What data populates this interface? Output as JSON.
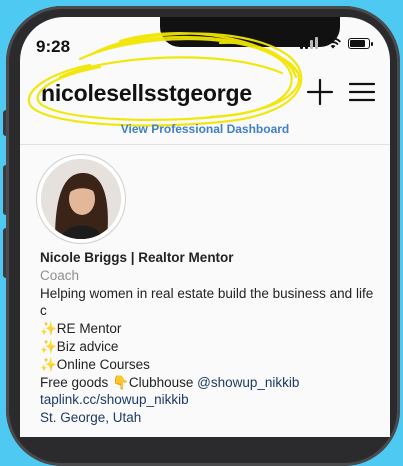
{
  "status_bar": {
    "time": "9:28"
  },
  "header": {
    "username": "nicolesellsstgeorge"
  },
  "dashboard": {
    "label": "View Professional Dashboard"
  },
  "profile": {
    "name": "Nicole Briggs | Realtor Mentor",
    "category": "Coach",
    "bio_intro": "Helping women in real estate build the business and life c",
    "bullets": [
      "✨RE Mentor",
      "✨Biz advice",
      "✨Online Courses"
    ],
    "free_goods_text": "Free goods 👇Clubhouse",
    "clubhouse_handle": "@showup_nikkib",
    "link": "taplink.cc/showup_nikkib",
    "location": "St. George, Utah"
  },
  "icons": {
    "plus": "plus-icon",
    "menu": "hamburger-menu-icon"
  },
  "colors": {
    "background": "#4ec9f2",
    "scribble": "#f2e600",
    "link": "#3f7fcb"
  }
}
